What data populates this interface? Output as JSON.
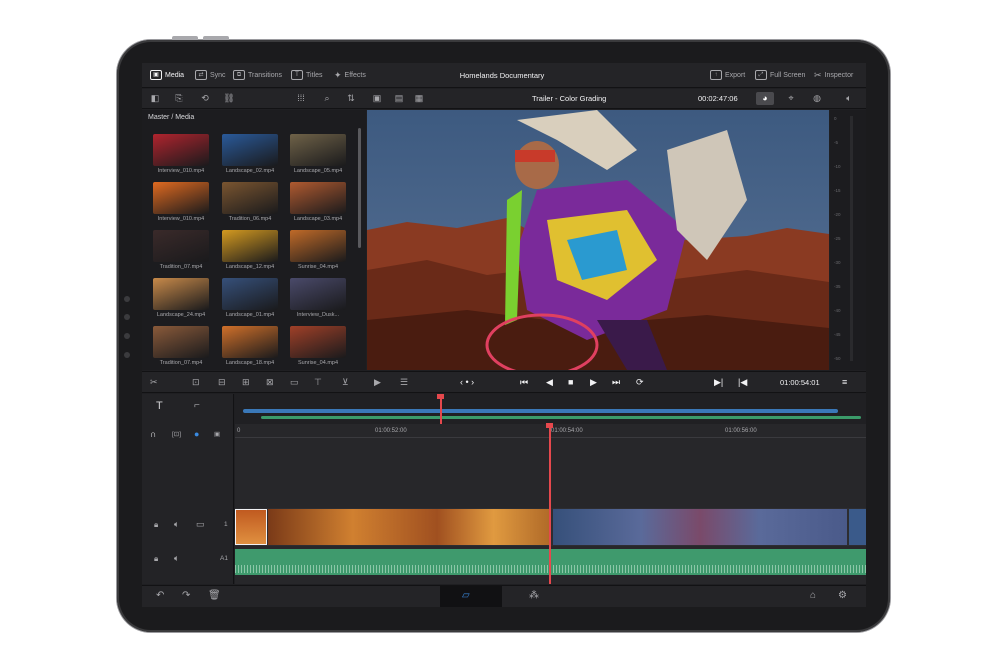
{
  "topbar": {
    "tabs": [
      {
        "label": "Media",
        "icon": "media-icon",
        "active": true
      },
      {
        "label": "Sync",
        "icon": "sync-icon",
        "active": false
      },
      {
        "label": "Transitions",
        "icon": "transitions-icon",
        "active": false
      },
      {
        "label": "Titles",
        "icon": "titles-icon",
        "active": false
      },
      {
        "label": "Effects",
        "icon": "effects-icon",
        "active": false
      }
    ],
    "project_title": "Homelands Documentary",
    "actions": [
      {
        "label": "Export",
        "icon": "export-icon"
      },
      {
        "label": "Full Screen",
        "icon": "fullscreen-icon"
      },
      {
        "label": "Inspector",
        "icon": "inspector-icon"
      }
    ]
  },
  "viewer_bar": {
    "timeline_name": "Trailer - Color Grading",
    "timecode": "00:02:47:06"
  },
  "media_pool": {
    "breadcrumb": "Master / Media",
    "clips": [
      {
        "name": "Interview_010.mp4",
        "color": "#b0242e"
      },
      {
        "name": "Landscape_02.mp4",
        "color": "#2a5a9a"
      },
      {
        "name": "Landscape_05.mp4",
        "color": "#6f6248"
      },
      {
        "name": "Interview_010.mp4",
        "color": "#e06a20"
      },
      {
        "name": "Tradition_06.mp4",
        "color": "#7a5530"
      },
      {
        "name": "Landscape_03.mp4",
        "color": "#b05a30"
      },
      {
        "name": "Tradition_07.mp4",
        "color": "#3a2a2a"
      },
      {
        "name": "Landscape_12.mp4",
        "color": "#d49a20"
      },
      {
        "name": "Sunrise_04.mp4",
        "color": "#c06a28"
      },
      {
        "name": "Landscape_24.mp4",
        "color": "#c88a4a"
      },
      {
        "name": "Landscape_01.mp4",
        "color": "#36507a"
      },
      {
        "name": "Interview_Dusk...",
        "color": "#4a4a6a"
      },
      {
        "name": "Tradition_07.mp4",
        "color": "#8a5a3a"
      },
      {
        "name": "Landscape_18.mp4",
        "color": "#d0702a"
      },
      {
        "name": "Sunrise_04.mp4",
        "color": "#a04028"
      }
    ]
  },
  "audio_meter": {
    "ticks": [
      "0",
      "-5",
      "-10",
      "-15",
      "-20",
      "-25",
      "-30",
      "-35",
      "-40",
      "-45",
      "-50"
    ]
  },
  "transport": {
    "timecode": "01:00:54:01"
  },
  "timeline": {
    "ruler_labels": [
      "0",
      "01:00:52:00",
      "01:00:54:00",
      "01:00:56:00"
    ],
    "video_track_label": "1",
    "audio_track_label": "A1"
  },
  "colors": {
    "accent_red": "#e5484d",
    "audio_green": "#3f9a6d",
    "clip_blue": "#3a78b8"
  }
}
